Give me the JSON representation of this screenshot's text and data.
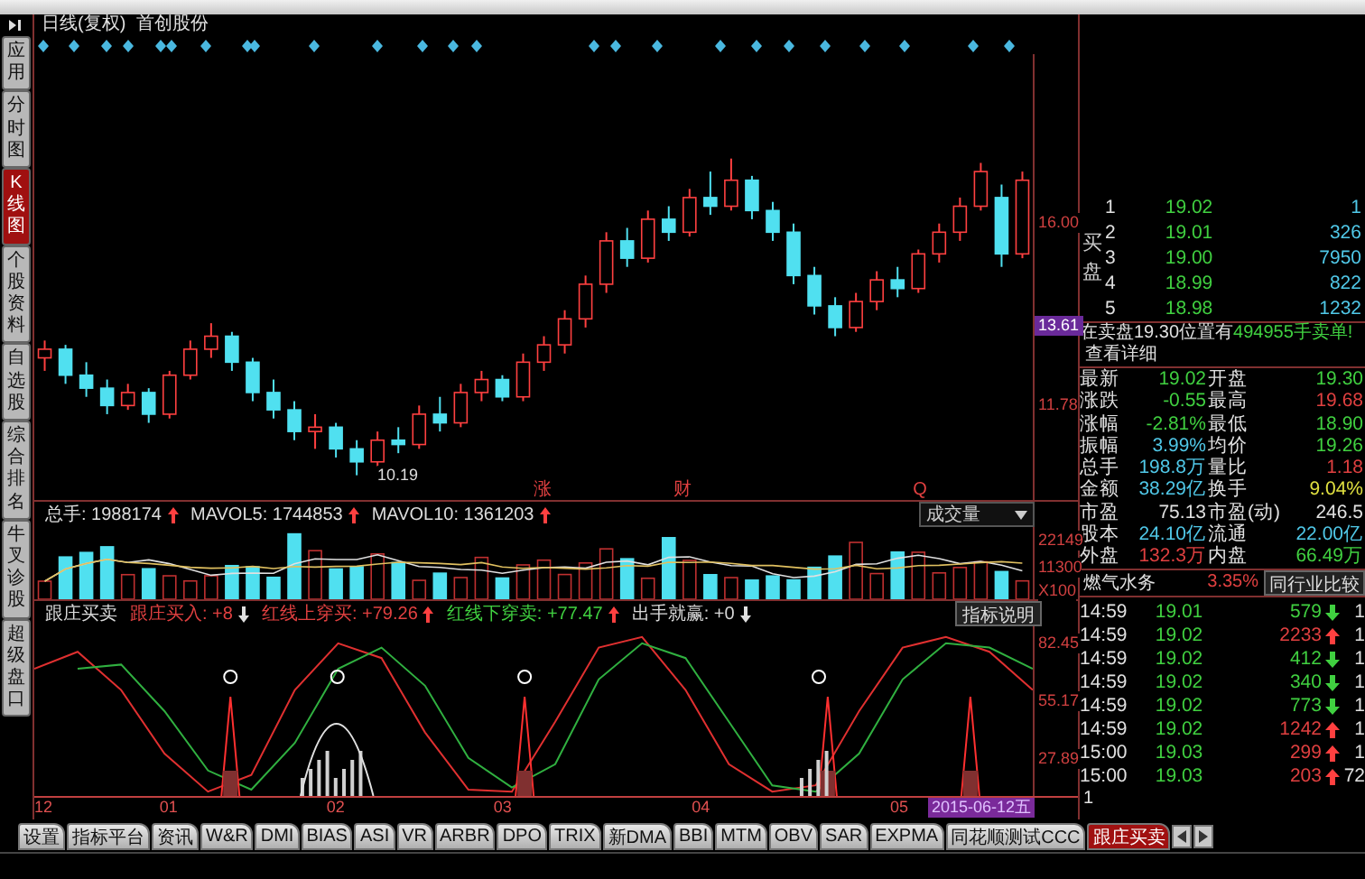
{
  "chart_title": {
    "period": "日线(复权)",
    "stock": "首创股份"
  },
  "sidebar": {
    "items": [
      {
        "label": "应用",
        "selected": false
      },
      {
        "label": "分时图",
        "selected": false
      },
      {
        "label": "K线图",
        "selected": true
      },
      {
        "label": "个股资料",
        "selected": false
      },
      {
        "label": "自选股",
        "selected": false
      },
      {
        "label": "综合排名",
        "selected": false
      },
      {
        "label": "牛叉诊股",
        "selected": false
      },
      {
        "label": "超级盘口",
        "selected": false
      }
    ]
  },
  "price_chart": {
    "cursor_price": "13.61",
    "low_label": "10.19",
    "event_marks": [
      "涨",
      "财",
      "Q"
    ],
    "chart_data": {
      "type": "candlestick",
      "ylim": [
        9.62,
        19.91
      ],
      "yticks": [
        {
          "value": 16,
          "label": "16.00"
        },
        {
          "value": 11.78,
          "label": "11.78"
        }
      ],
      "ohlc": [
        [
          12.9,
          13.3,
          12.6,
          13.1
        ],
        [
          13.1,
          13.2,
          12.3,
          12.5
        ],
        [
          12.5,
          12.8,
          12.0,
          12.2
        ],
        [
          12.2,
          12.4,
          11.6,
          11.8
        ],
        [
          11.8,
          12.3,
          11.7,
          12.1
        ],
        [
          12.1,
          12.2,
          11.4,
          11.6
        ],
        [
          11.6,
          12.6,
          11.5,
          12.5
        ],
        [
          12.5,
          13.3,
          12.4,
          13.1
        ],
        [
          13.1,
          13.7,
          12.9,
          13.4
        ],
        [
          13.4,
          13.5,
          12.6,
          12.8
        ],
        [
          12.8,
          12.9,
          11.9,
          12.1
        ],
        [
          12.1,
          12.4,
          11.5,
          11.7
        ],
        [
          11.7,
          11.9,
          11.0,
          11.2
        ],
        [
          11.2,
          11.6,
          10.8,
          11.3
        ],
        [
          11.3,
          11.4,
          10.6,
          10.8
        ],
        [
          10.8,
          11.0,
          10.19,
          10.5
        ],
        [
          10.5,
          11.2,
          10.4,
          11.0
        ],
        [
          11.0,
          11.3,
          10.7,
          10.9
        ],
        [
          10.9,
          11.8,
          10.8,
          11.6
        ],
        [
          11.6,
          12.0,
          11.2,
          11.4
        ],
        [
          11.4,
          12.3,
          11.3,
          12.1
        ],
        [
          12.1,
          12.6,
          11.9,
          12.4
        ],
        [
          12.4,
          12.5,
          11.9,
          12.0
        ],
        [
          12.0,
          13.0,
          11.9,
          12.8
        ],
        [
          12.8,
          13.4,
          12.6,
          13.2
        ],
        [
          13.2,
          14.0,
          13.0,
          13.8
        ],
        [
          13.8,
          14.8,
          13.6,
          14.6
        ],
        [
          14.6,
          15.8,
          14.4,
          15.6
        ],
        [
          15.6,
          15.9,
          15.0,
          15.2
        ],
        [
          15.2,
          16.3,
          15.1,
          16.1
        ],
        [
          16.1,
          16.4,
          15.6,
          15.8
        ],
        [
          15.8,
          16.8,
          15.7,
          16.6
        ],
        [
          16.6,
          17.2,
          16.2,
          16.4
        ],
        [
          16.4,
          17.5,
          16.3,
          17.0
        ],
        [
          17.0,
          17.1,
          16.1,
          16.3
        ],
        [
          16.3,
          16.5,
          15.6,
          15.8
        ],
        [
          15.8,
          16.0,
          14.6,
          14.8
        ],
        [
          14.8,
          15.0,
          13.9,
          14.1
        ],
        [
          14.1,
          14.3,
          13.4,
          13.6
        ],
        [
          13.6,
          14.4,
          13.5,
          14.2
        ],
        [
          14.2,
          14.9,
          14.0,
          14.7
        ],
        [
          14.7,
          15.0,
          14.3,
          14.5
        ],
        [
          14.5,
          15.4,
          14.4,
          15.3
        ],
        [
          15.3,
          16.0,
          15.1,
          15.8
        ],
        [
          15.8,
          16.6,
          15.6,
          16.4
        ],
        [
          16.4,
          17.4,
          16.3,
          17.2
        ],
        [
          16.6,
          16.9,
          15.0,
          15.3
        ],
        [
          15.3,
          17.2,
          15.2,
          17.0
        ]
      ]
    }
  },
  "volume": {
    "header": [
      {
        "label": "总手:",
        "value": "1988174",
        "up": true
      },
      {
        "label": "MAVOL5:",
        "value": "1744853",
        "up": true
      },
      {
        "label": "MAVOL10:",
        "value": "1361203",
        "up": true
      }
    ],
    "selector": "成交量",
    "axis": [
      "22149",
      "11300",
      "X100"
    ]
  },
  "indicator": {
    "name": "跟庄买卖",
    "items": [
      {
        "label": "跟庄买入:",
        "value": "+8",
        "up": false,
        "color": "#e04040"
      },
      {
        "label": "红线上穿买:",
        "value": "+79.26",
        "up": true,
        "color": "#e04040"
      },
      {
        "label": "红线下穿卖:",
        "value": "+77.47",
        "up": true,
        "color": "#40d040"
      },
      {
        "label": "出手就赢:",
        "value": "+0",
        "up": false,
        "color": "#d8d8d8"
      }
    ],
    "help_button": "指标说明",
    "chart_data": {
      "type": "line",
      "ylim": [
        10,
        90
      ],
      "yticks": [
        82.45,
        55.17,
        27.89
      ],
      "series": [
        {
          "color": "#e03030",
          "values": [
            70,
            78,
            60,
            30,
            12,
            20,
            60,
            82,
            75,
            40,
            13,
            12,
            45,
            80,
            85,
            60,
            25,
            12,
            15,
            50,
            80,
            85,
            78,
            60
          ]
        },
        {
          "color": "#30b040",
          "values": [
            null,
            70,
            72,
            50,
            22,
            13,
            35,
            70,
            80,
            62,
            28,
            14,
            25,
            65,
            82,
            75,
            45,
            15,
            12,
            30,
            65,
            82,
            80,
            70
          ]
        }
      ]
    }
  },
  "x_axis": {
    "labels": [
      "12",
      "01",
      "02",
      "03",
      "04",
      "05"
    ],
    "cursor_date": "2015-06-12五"
  },
  "bottom_tabs": [
    {
      "label": "设置",
      "selected": false
    },
    {
      "label": "指标平台",
      "selected": false
    },
    {
      "label": "资讯",
      "selected": false
    },
    {
      "label": "W&R",
      "selected": false
    },
    {
      "label": "DMI",
      "selected": false
    },
    {
      "label": "BIAS",
      "selected": false
    },
    {
      "label": "ASI",
      "selected": false
    },
    {
      "label": "VR",
      "selected": false
    },
    {
      "label": "ARBR",
      "selected": false
    },
    {
      "label": "DPO",
      "selected": false
    },
    {
      "label": "TRIX",
      "selected": false
    },
    {
      "label": "新DMA",
      "selected": false
    },
    {
      "label": "BBI",
      "selected": false
    },
    {
      "label": "MTM",
      "selected": false
    },
    {
      "label": "OBV",
      "selected": false
    },
    {
      "label": "SAR",
      "selected": false
    },
    {
      "label": "EXPMA",
      "selected": false
    },
    {
      "label": "同花顺测试CCC",
      "selected": false
    },
    {
      "label": "跟庄买卖",
      "selected": true
    }
  ],
  "quote_panel": {
    "buy_label": "买盘",
    "buy_levels": [
      {
        "level": "1",
        "price": "19.02",
        "volume": "1"
      },
      {
        "level": "2",
        "price": "19.01",
        "volume": "326"
      },
      {
        "level": "3",
        "price": "19.00",
        "volume": "7950"
      },
      {
        "level": "4",
        "price": "18.99",
        "volume": "822"
      },
      {
        "level": "5",
        "price": "18.98",
        "volume": "1232"
      }
    ],
    "notice": {
      "prefix": "在卖盘19.30位置有",
      "amount": "494955手卖单!",
      "link": "查看详细"
    },
    "stats": [
      {
        "label": "最新",
        "value": "19.02",
        "color": "#40d040"
      },
      {
        "label": "开盘",
        "value": "19.30",
        "color": "#40d040"
      },
      {
        "label": "涨跌",
        "value": "-0.55",
        "color": "#40d040"
      },
      {
        "label": "最高",
        "value": "19.68",
        "color": "#e04040"
      },
      {
        "label": "涨幅",
        "value": "-2.81%",
        "color": "#40d040"
      },
      {
        "label": "最低",
        "value": "18.90",
        "color": "#40d040"
      },
      {
        "label": "振幅",
        "value": "3.99%",
        "color": "#50c8e8"
      },
      {
        "label": "均价",
        "value": "19.26",
        "color": "#40d040"
      },
      {
        "label": "总手",
        "value": "198.8万",
        "color": "#50c8e8"
      },
      {
        "label": "量比",
        "value": "1.18",
        "color": "#e04040"
      },
      {
        "label": "金额",
        "value": "38.29亿",
        "color": "#50c8e8"
      },
      {
        "label": "换手",
        "value": "9.04%",
        "color": "#e0e040"
      },
      {
        "label": "市盈",
        "value": "75.13",
        "color": "#e0e0e0"
      },
      {
        "label": "市盈(动)",
        "value": "246.5",
        "color": "#e0e0e0"
      },
      {
        "label": "股本",
        "value": "24.10亿",
        "color": "#50c8e8"
      },
      {
        "label": "流通",
        "value": "22.00亿",
        "color": "#50c8e8"
      },
      {
        "label": "外盘",
        "value": "132.3万",
        "color": "#e04040"
      },
      {
        "label": "内盘",
        "value": "66.49万",
        "color": "#40d040"
      }
    ],
    "sector": {
      "name": "燃气水务",
      "change": "3.35%",
      "compare_button": "同行业比较"
    },
    "ticks": [
      {
        "time": "14:59",
        "price": "19.01",
        "volume": "579",
        "up": false,
        "column_4": "1"
      },
      {
        "time": "14:59",
        "price": "19.02",
        "volume": "2233",
        "up": true,
        "column_4": "1"
      },
      {
        "time": "14:59",
        "price": "19.02",
        "volume": "412",
        "up": false,
        "column_4": "1"
      },
      {
        "time": "14:59",
        "price": "19.02",
        "volume": "340",
        "up": false,
        "column_4": "1"
      },
      {
        "time": "14:59",
        "price": "19.02",
        "volume": "773",
        "up": false,
        "column_4": "1"
      },
      {
        "time": "14:59",
        "price": "19.02",
        "volume": "1242",
        "up": true,
        "column_4": "1"
      },
      {
        "time": "15:00",
        "price": "19.03",
        "volume": "299",
        "up": true,
        "column_4": "1"
      },
      {
        "time": "15:00",
        "price": "19.03",
        "volume": "203",
        "up": true,
        "column_4": "72"
      }
    ],
    "ticks_footer": "1"
  }
}
